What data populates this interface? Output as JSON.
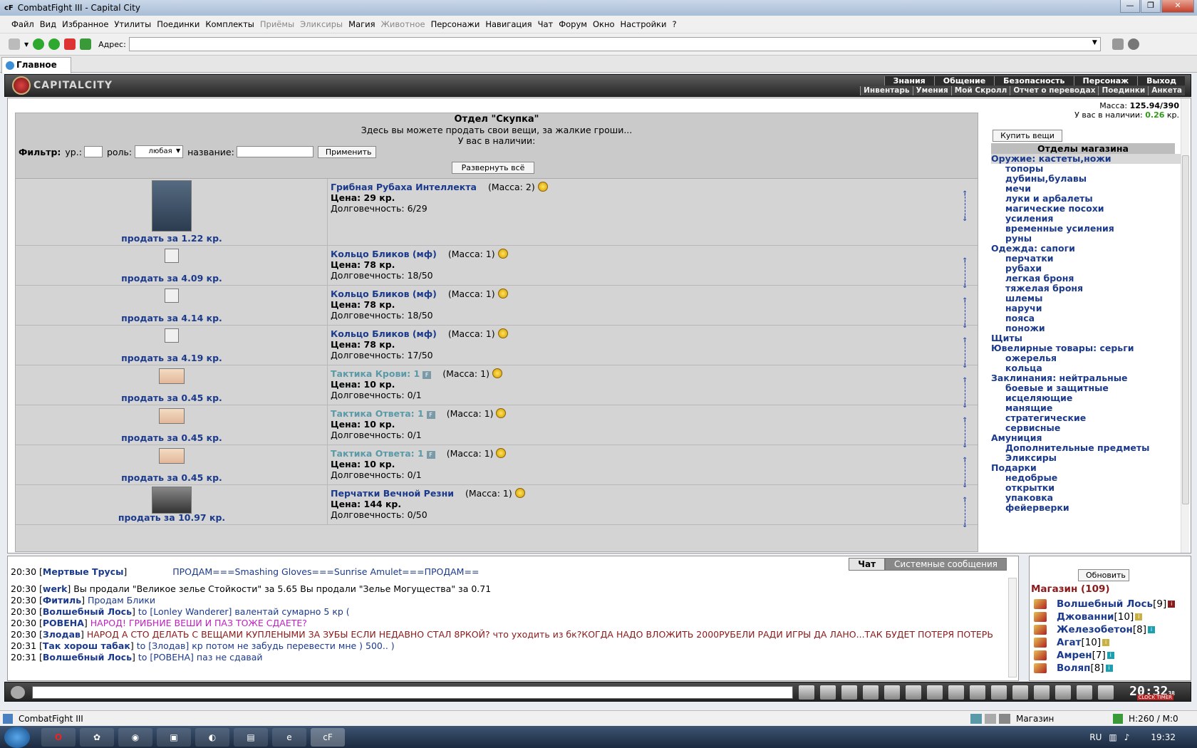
{
  "window": {
    "title": "CombatFight III - Capital City"
  },
  "menu": [
    {
      "label": "Файл",
      "disabled": false
    },
    {
      "label": "Вид",
      "disabled": false
    },
    {
      "label": "Избранное",
      "disabled": false
    },
    {
      "label": "Утилиты",
      "disabled": false
    },
    {
      "label": "Поединки",
      "disabled": false
    },
    {
      "label": "Комплекты",
      "disabled": false
    },
    {
      "label": "Приёмы",
      "disabled": true
    },
    {
      "label": "Эликсиры",
      "disabled": true
    },
    {
      "label": "Магия",
      "disabled": false
    },
    {
      "label": "Животное",
      "disabled": true
    },
    {
      "label": "Персонажи",
      "disabled": false
    },
    {
      "label": "Навигация",
      "disabled": false
    },
    {
      "label": "Чат",
      "disabled": false
    },
    {
      "label": "Форум",
      "disabled": false
    },
    {
      "label": "Окно",
      "disabled": false
    },
    {
      "label": "Настройки",
      "disabled": false
    },
    {
      "label": "?",
      "disabled": false
    }
  ],
  "toolbar": {
    "address_label": "Адрес:",
    "address_value": ""
  },
  "tab": {
    "label": "Главное"
  },
  "game": {
    "logo": "CAPITALCITY",
    "topnav": [
      "Знания",
      "Общение",
      "Безопасность",
      "Персонаж",
      "Выход"
    ],
    "subnav": [
      "Инвентарь",
      "Умения",
      "Мой Скролл",
      "Отчет о переводах",
      "Поединки",
      "Анкета"
    ]
  },
  "shop": {
    "title": "Отдел \"Скупка\"",
    "subtitle": "Здесь вы можете продать свои вещи, за жалкие гроши...",
    "have": "У вас в наличии:",
    "filter": {
      "label": "Фильтр:",
      "level_label": "ур.:",
      "role_label": "роль:",
      "role_value": "любая",
      "name_label": "название:",
      "apply": "Применить"
    },
    "expand": "Развернуть всё",
    "items": [
      {
        "sell": "продать за 1.22 кр.",
        "name": "Грибная Рубаха Интеллекта",
        "mass": "(Масса: 2)",
        "price": "Цена: 29 кр.",
        "dur": "Долговечность: 6/29",
        "kind": "shirt",
        "grey": false,
        "f": false
      },
      {
        "sell": "продать за 4.09 кр.",
        "name": "Кольцо Бликов (мф)",
        "mass": "(Масса: 1)",
        "price": "Цена: 78 кр.",
        "dur": "Долговечность: 18/50",
        "kind": "ring",
        "grey": false,
        "f": false
      },
      {
        "sell": "продать за 4.14 кр.",
        "name": "Кольцо Бликов (мф)",
        "mass": "(Масса: 1)",
        "price": "Цена: 78 кр.",
        "dur": "Долговечность: 18/50",
        "kind": "ring",
        "grey": false,
        "f": false
      },
      {
        "sell": "продать за 4.19 кр.",
        "name": "Кольцо Бликов (мф)",
        "mass": "(Масса: 1)",
        "price": "Цена: 78 кр.",
        "dur": "Долговечность: 17/50",
        "kind": "ring",
        "grey": false,
        "f": false
      },
      {
        "sell": "продать за 0.45 кр.",
        "name": "Тактика Крови: 1",
        "mass": "(Масса: 1)",
        "price": "Цена: 10 кр.",
        "dur": "Долговечность: 0/1",
        "kind": "scroll",
        "grey": true,
        "f": true
      },
      {
        "sell": "продать за 0.45 кр.",
        "name": "Тактика Ответа: 1",
        "mass": "(Масса: 1)",
        "price": "Цена: 10 кр.",
        "dur": "Долговечность: 0/1",
        "kind": "scroll",
        "grey": true,
        "f": true
      },
      {
        "sell": "продать за 0.45 кр.",
        "name": "Тактика Ответа: 1",
        "mass": "(Масса: 1)",
        "price": "Цена: 10 кр.",
        "dur": "Долговечность: 0/1",
        "kind": "scroll",
        "grey": true,
        "f": true
      },
      {
        "sell": "продать за 10.97 кр.",
        "name": "Перчатки Вечной Резни",
        "mass": "(Масса: 1)",
        "price": "Цена: 144 кр.",
        "dur": "Долговечность: 0/50",
        "kind": "gloves",
        "grey": false,
        "f": false
      }
    ]
  },
  "right": {
    "mass_label": "Масса:",
    "mass_value": "125.94/390",
    "money_label": "У вас в наличии:",
    "money_value": "0.26",
    "money_unit": "кр.",
    "buy": "Купить вещи",
    "depts_title": "Отделы магазина",
    "cats": [
      {
        "t": "Оружие: кастеты,ножи",
        "sub": false,
        "hl": true
      },
      {
        "t": "топоры",
        "sub": true
      },
      {
        "t": "дубины,булавы",
        "sub": true
      },
      {
        "t": "мечи",
        "sub": true
      },
      {
        "t": "луки и арбалеты",
        "sub": true
      },
      {
        "t": "магические посохи",
        "sub": true
      },
      {
        "t": "усиления",
        "sub": true
      },
      {
        "t": "временные усиления",
        "sub": true
      },
      {
        "t": "руны",
        "sub": true
      },
      {
        "t": "Одежда: сапоги",
        "sub": false
      },
      {
        "t": "перчатки",
        "sub": true
      },
      {
        "t": "рубахи",
        "sub": true
      },
      {
        "t": "легкая броня",
        "sub": true
      },
      {
        "t": "тяжелая броня",
        "sub": true
      },
      {
        "t": "шлемы",
        "sub": true
      },
      {
        "t": "наручи",
        "sub": true
      },
      {
        "t": "пояса",
        "sub": true
      },
      {
        "t": "поножи",
        "sub": true
      },
      {
        "t": "Щиты",
        "sub": false
      },
      {
        "t": "Ювелирные товары: серьги",
        "sub": false
      },
      {
        "t": "ожерелья",
        "sub": true
      },
      {
        "t": "кольца",
        "sub": true
      },
      {
        "t": "Заклинания: нейтральные",
        "sub": false
      },
      {
        "t": "боевые и защитные",
        "sub": true
      },
      {
        "t": "исцеляющие",
        "sub": true
      },
      {
        "t": "манящие",
        "sub": true
      },
      {
        "t": "стратегические",
        "sub": true
      },
      {
        "t": "сервисные",
        "sub": true
      },
      {
        "t": "Амуниция",
        "sub": false
      },
      {
        "t": "Дополнительные предметы",
        "sub": true
      },
      {
        "t": "Эликсиры",
        "sub": true
      },
      {
        "t": "Подарки",
        "sub": false
      },
      {
        "t": "недобрые",
        "sub": true
      },
      {
        "t": "открытки",
        "sub": true
      },
      {
        "t": "упаковка",
        "sub": true
      },
      {
        "t": "фейерверки",
        "sub": true
      }
    ]
  },
  "chat": {
    "tabs": [
      "Чат",
      "Системные сообщения"
    ],
    "messages": [
      {
        "time": "20:30",
        "nick": "Мертвые Трусы",
        "text": "ПРОДАМ===Smashing Gloves===Sunrise Amulet===ПРОДАМ==",
        "cls": "bl"
      },
      {
        "time": "20:30",
        "nick": "werk",
        "text": "Вы продали \"Великое зелье Стойкости\" за 5.65 Вы продали \"Зелье Могущества\" за 0.71",
        "cls": ""
      },
      {
        "time": "20:30",
        "nick": "Фитиль",
        "text": "Продам Блики",
        "cls": "bl"
      },
      {
        "time": "20:30",
        "nick": "Волшебный Лось",
        "text": "to [Lonley Wanderer] валентай сумарно 5 кр (",
        "cls": "bl"
      },
      {
        "time": "20:30",
        "nick": "РОВЕНА",
        "text": "НАРОД! ГРИБНИЕ ВЕШИ И ПАЗ ТОЖЕ СДАЕТЕ?",
        "cls": "pk"
      },
      {
        "time": "20:30",
        "nick": "Злодав",
        "text": "НАРОД А СТО ДЕЛАТЬ С ВЕЩАМИ КУПЛЕНЫМИ ЗА ЗУБЫ ЕСЛИ НЕДАВНО СТАЛ 8РКОЙ? что уходить из бк?КОГДА НАДО ВЛОЖИТЬ 2000РУБЕЛИ РАДИ ИГРЫ ДА ЛАНО...ТАК БУДЕТ ПОТЕРЯ ПОТЕРЬ",
        "cls": "br"
      },
      {
        "time": "20:31",
        "nick": "Так хорош табак",
        "text": "to [Злодав] кр потом не забудь перевести мне ) 500.. )",
        "cls": "bl"
      },
      {
        "time": "20:31",
        "nick": "Волшебный Лось",
        "text": "to [РОВЕНА] паз не сдавай",
        "cls": "bl"
      }
    ]
  },
  "users": {
    "refresh": "Обновить",
    "title": "Магазин (109)",
    "list": [
      {
        "name": "Волшебный Лось",
        "lvl": "[9]",
        "badge": "#8b1a1a"
      },
      {
        "name": "Джованни",
        "lvl": "[10]",
        "badge": "#c9b040"
      },
      {
        "name": "Железобетон",
        "lvl": "[8]",
        "badge": "#1aa0b0"
      },
      {
        "name": "Агат",
        "lvl": "[10]",
        "badge": "#c9b040"
      },
      {
        "name": "Амрен",
        "lvl": "[7]",
        "badge": "#1aa0b0"
      },
      {
        "name": "Воляп",
        "lvl": "[8]",
        "badge": "#1aa0b0"
      }
    ]
  },
  "clock": {
    "time": "20:32",
    "sec": "38",
    "label": "CLOCK TIMER"
  },
  "status": {
    "left": "CombatFight III",
    "location": "Магазин",
    "hp": "H:260 / M:0"
  },
  "taskbar": {
    "lang": "RU",
    "time": "19:32"
  }
}
